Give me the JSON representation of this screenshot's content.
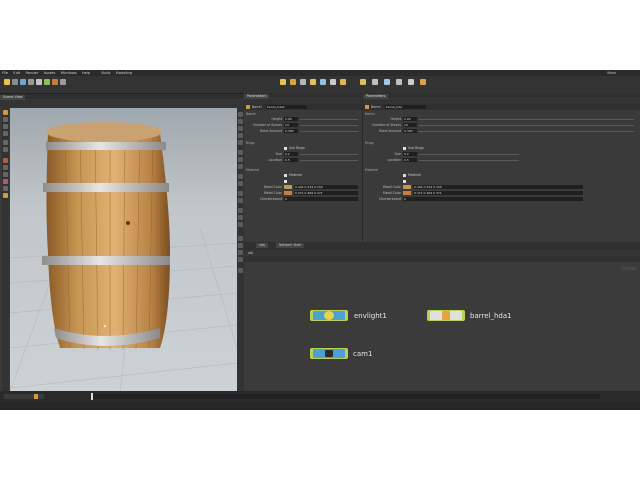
{
  "menu": [
    "File",
    "Edit",
    "Render",
    "Assets",
    "Windows",
    "Help"
  ],
  "build_label": "Build",
  "desktop_label": "Modeling",
  "main_label": "Main",
  "viewport_tab": "Scene View",
  "parm_left": {
    "tab": "Parameters",
    "node_type": "Barrel",
    "node_name": "barrel_hda1"
  },
  "parm_right": {
    "tab": "Parameters",
    "node_type": "Barrel",
    "node_name": "barrel_hda"
  },
  "params": {
    "section_barrel": "Barrel",
    "height_label": "Height",
    "height_val": "2.00",
    "staves_label": "Number of Staves",
    "staves_val": "24",
    "bend_label": "Bend Amount",
    "bend_val": "0.300",
    "section_rings": "Rings",
    "rings_label": "Use Rings",
    "size_label": "Size",
    "size_val": "0.2",
    "location_label": "Location",
    "location_val": "0.5",
    "section_material": "Material",
    "mat_label": "Material",
    "wood_label": "Wood Color",
    "wood_val": "0.444  0.344  0.154",
    "metal_label": "Metal Color",
    "metal_val": "0.371  0.369  0.371",
    "checker_label": "Checkerboard",
    "checker_val": "0"
  },
  "network": {
    "tab": "/obj",
    "label": "Network View",
    "path": "obj",
    "watermark": "Scene"
  },
  "nodes": {
    "envlight": "envlight1",
    "barrel": "barrel_hda1",
    "cam": "cam1"
  },
  "colors": {
    "wood": "#c79552",
    "metal": "#c7c7c7",
    "node_blue": "#4aa0d8",
    "node_green": "#b9d44a",
    "node_orange": "#e8a23a"
  }
}
